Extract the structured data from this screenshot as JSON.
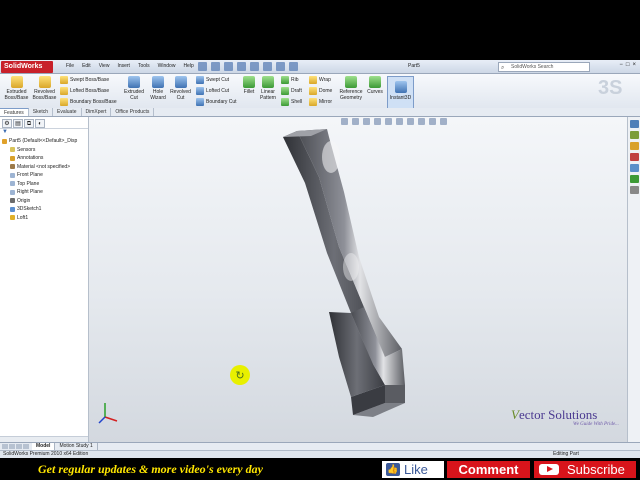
{
  "app": {
    "logo": "SolidWorks",
    "menus": [
      "File",
      "Edit",
      "View",
      "Insert",
      "Tools",
      "Window",
      "Help"
    ],
    "document_title": "Part5",
    "search_placeholder": "SolidWorks Search",
    "window_controls": [
      "−",
      "□",
      "×"
    ]
  },
  "command_manager": {
    "extruded_boss": "Extruded Boss/Base",
    "revolved_boss": "Revolved Boss/Base",
    "swept_boss": "Swept Boss/Base",
    "lofted_boss": "Lofted Boss/Base",
    "boundary_boss": "Boundary Boss/Base",
    "extruded_cut": "Extruded Cut",
    "hole_wizard": "Hole Wizard",
    "revolved_cut": "Revolved Cut",
    "swept_cut": "Swept Cut",
    "lofted_cut": "Lofted Cut",
    "boundary_cut": "Boundary Cut",
    "fillet": "Fillet",
    "linear_pattern": "Linear Pattern",
    "rib": "Rib",
    "draft": "Draft",
    "shell": "Shell",
    "wrap": "Wrap",
    "dome": "Dome",
    "mirror": "Mirror",
    "reference_geometry": "Reference Geometry",
    "curves": "Curves",
    "instant3d": "Instant3D"
  },
  "tabs": [
    "Features",
    "Sketch",
    "Evaluate",
    "DimXpert",
    "Office Products"
  ],
  "active_tab": "Features",
  "feature_tree": {
    "root": "Part5  (Default<<Default>_Disp",
    "items": [
      "Sensors",
      "Annotations",
      "Material <not specified>",
      "Front Plane",
      "Top Plane",
      "Right Plane",
      "Origin",
      "3DSketch1",
      "Loft1"
    ]
  },
  "model_tabs": [
    "Model",
    "Motion Study 1"
  ],
  "status": {
    "left": "SolidWorks Premium 2010 x64 Edition",
    "right": "Editing Part"
  },
  "watermark": {
    "name_v": "V",
    "name_rest": "ector Solutions",
    "tagline": "We Guide With Pride..."
  },
  "promo": {
    "text": "Get regular updates & more video's every day",
    "like": "Like",
    "comment": "Comment",
    "subscribe": "Subscribe"
  },
  "colors": {
    "brand_red": "#c8202a",
    "banner_yellow": "#ffe600",
    "youtube_red": "#d8141b",
    "facebook_blue": "#3b5998",
    "cursor_yellow": "#e8f000"
  }
}
